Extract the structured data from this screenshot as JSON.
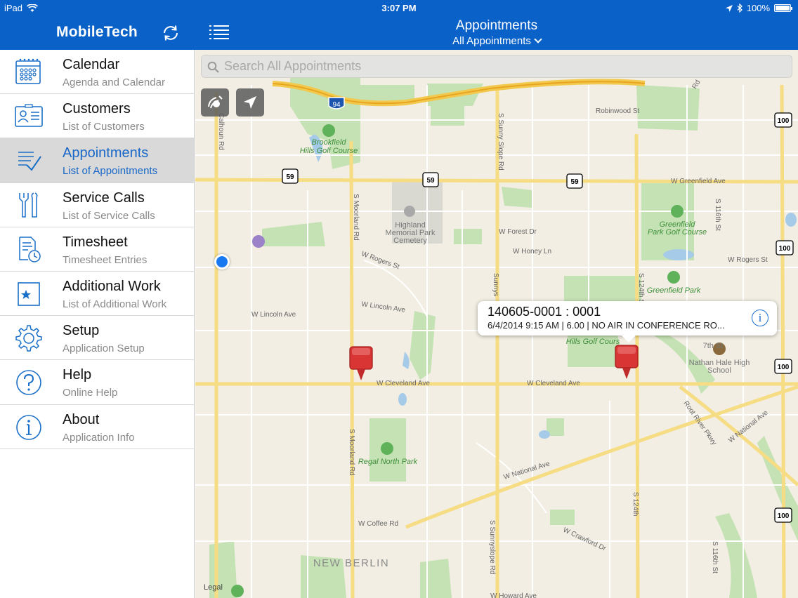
{
  "status": {
    "device": "iPad",
    "time": "3:07 PM",
    "battery": "100%"
  },
  "header": {
    "app_title": "MobileTech",
    "nav_title": "Appointments",
    "nav_subtitle": "All Appointments"
  },
  "sidebar": {
    "items": [
      {
        "label": "Calendar",
        "sub": "Agenda and Calendar",
        "icon": "calendar-icon"
      },
      {
        "label": "Customers",
        "sub": "List of Customers",
        "icon": "contact-card-icon"
      },
      {
        "label": "Appointments",
        "sub": "List of Appointments",
        "icon": "checklist-icon"
      },
      {
        "label": "Service Calls",
        "sub": "List of Service Calls",
        "icon": "tools-icon"
      },
      {
        "label": "Timesheet",
        "sub": "Timesheet Entries",
        "icon": "timesheet-clock-icon"
      },
      {
        "label": "Additional Work",
        "sub": "List of Additional Work",
        "icon": "star-document-icon"
      },
      {
        "label": "Setup",
        "sub": "Application Setup",
        "icon": "gear-icon"
      },
      {
        "label": "Help",
        "sub": "Online Help",
        "icon": "question-icon"
      },
      {
        "label": "About",
        "sub": "Application Info",
        "icon": "info-icon"
      }
    ],
    "active_index": 2
  },
  "search": {
    "placeholder": "Search All Appointments"
  },
  "callout": {
    "title": "140605-0001 : 0001",
    "subtitle": "6/4/2014 9:15 AM | 6.00 | NO AIR IN CONFERENCE RO..."
  },
  "map": {
    "legal": "Legal",
    "labels": {
      "brookfield": "Brookfield",
      "hills_golf": "Hills Golf Course",
      "highland": "Highland",
      "memorial_park": "Memorial Park",
      "cemetery": "Cemetery",
      "greenfield": "Greenfield",
      "park_golf": "Park Golf Course",
      "greenfield_park": "Greenfield Park",
      "hills_golf_2": "Hills Golf Cours",
      "nathan_hale": "Nathan Hale High",
      "school": "School",
      "regal_north": "Regal North Park",
      "new_berlin": "NEW BERLIN",
      "robinwood": "Robinwood St",
      "greenfield_ave": "W Greenfield Ave",
      "forest_dr": "W Forest Dr",
      "honey_ln": "W Honey Ln",
      "rogers_st": "W Rogers St",
      "rogers_st_2": "W Rogers St",
      "lincoln_ave": "W Lincoln Ave",
      "lincoln_ave_2": "W Lincoln Ave",
      "cleveland_ave": "W Cleveland Ave",
      "cleveland_ave_2": "W Cleveland Ave",
      "national_ave": "W National Ave",
      "national_ave_2": "W National Ave",
      "coffee_rd": "W Coffee Rd",
      "crawford_dr": "W Crawford Dr",
      "howard_ave": "W Howard Ave",
      "root_river": "Root River Pkwy",
      "moorland_rd": "S Moorland Rd",
      "moorland_rd_2": "S Moorland Rd",
      "sunny_slope": "S Sunny Slope Rd",
      "sunnyslope": "S Sunnyslope Rd",
      "sunnyslope_short": "Sunnys",
      "s124th": "S 124th St",
      "s124th_2": "S 124th St",
      "s124th_3": "S 124th",
      "s116th": "S 116th St",
      "s116th_2": "S 116th St",
      "calhoun_rd": "Calhoun Rd",
      "seventh_st": "7th St",
      "rd_fragment": "Rd",
      "i94": "94",
      "r59": "59",
      "r100": "100"
    }
  }
}
